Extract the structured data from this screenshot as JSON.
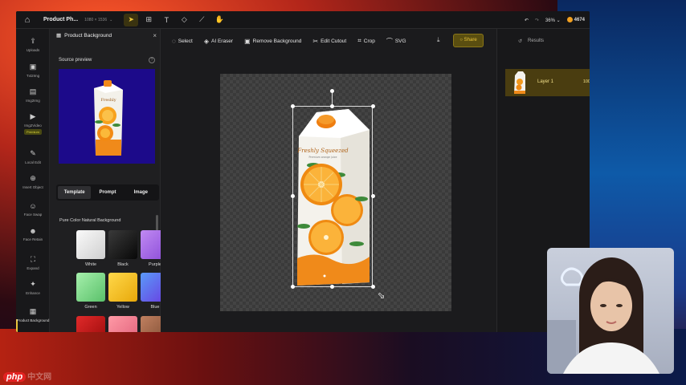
{
  "topbar": {
    "title": "Product Ph...",
    "size": "1080 × 1536",
    "zoom": "36%",
    "credits": "4674"
  },
  "sidebar": {
    "items": [
      {
        "label": "Uploads",
        "icon": "upload-icon"
      },
      {
        "label": "Txt2Img",
        "icon": "text-image-icon"
      },
      {
        "label": "Img2Img",
        "icon": "image-image-icon"
      },
      {
        "label": "Img2Video",
        "icon": "video-icon",
        "badge": "Premium"
      },
      {
        "label": "Local Edit",
        "icon": "brush-icon"
      },
      {
        "label": "Insert Object",
        "icon": "insert-icon"
      },
      {
        "label": "Face Swap",
        "icon": "face-swap-icon"
      },
      {
        "label": "Face Retain",
        "icon": "face-retain-icon"
      },
      {
        "label": "Expand",
        "icon": "expand-icon"
      },
      {
        "label": "Enhance",
        "icon": "enhance-icon"
      },
      {
        "label": "Product Background",
        "icon": "product-bg-icon"
      }
    ]
  },
  "panel": {
    "title": "Product Background",
    "source_label": "Source preview",
    "tabs": [
      "Template",
      "Prompt",
      "Image"
    ],
    "section_label": "Pure Color Natural Background",
    "swatches": [
      {
        "label": "White",
        "color": "#e8e8e8"
      },
      {
        "label": "Black",
        "color": "#151515"
      },
      {
        "label": "Purple",
        "color": "#a66ae0"
      },
      {
        "label": "Green",
        "color": "#7fd98a"
      },
      {
        "label": "Yellow",
        "color": "#f2c21a"
      },
      {
        "label": "Blue",
        "color": "#4a6cf0"
      },
      {
        "label": "",
        "color": "#c81818"
      },
      {
        "label": "",
        "color": "#f07a8a"
      },
      {
        "label": "",
        "color": "#a06a4a"
      }
    ]
  },
  "toolbar": {
    "items": [
      {
        "label": "Select",
        "icon": "lasso-icon"
      },
      {
        "label": "AI Eraser",
        "icon": "eraser-icon"
      },
      {
        "label": "Remove Background",
        "icon": "remove-bg-icon"
      },
      {
        "label": "Edit Cutout",
        "icon": "cutout-icon"
      },
      {
        "label": "Crop",
        "icon": "crop-icon"
      },
      {
        "label": "SVG",
        "icon": "svg-icon"
      }
    ],
    "share_label": "Share"
  },
  "product": {
    "brand": "Freshly Squeezed",
    "tagline": "Premium orange juice"
  },
  "right_panel": {
    "results_label": "Results",
    "layer_name": "Layer 1",
    "layer_opacity": "100"
  },
  "watermark": {
    "badge": "php",
    "rest": "中文网"
  },
  "colors": {
    "accent": "#e9c43a",
    "source_bg": "#1c0a8a",
    "juice_orange": "#f08a1a"
  }
}
